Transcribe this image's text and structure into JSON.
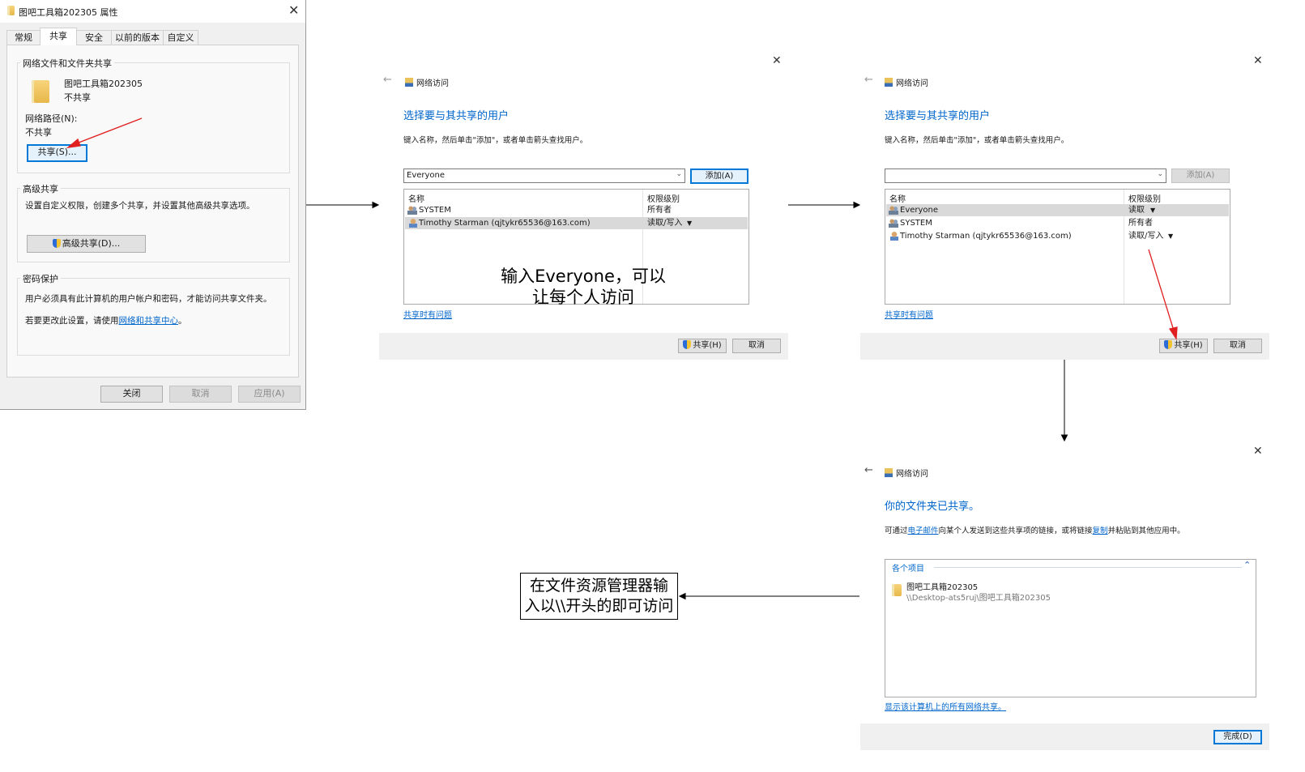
{
  "dialog": {
    "title": "图吧工具箱202305 属性",
    "tabs": [
      "常规",
      "共享",
      "安全",
      "以前的版本",
      "自定义"
    ],
    "active_tab_index": 1,
    "net_share_group": "网络文件和文件夹共享",
    "folder_name": "图吧工具箱202305",
    "folder_status": "不共享",
    "network_path_label": "网络路径(N):",
    "network_path_value": "不共享",
    "share_button": "共享(S)...",
    "advanced_group": "高级共享",
    "advanced_desc": "设置自定义权限，创建多个共享，并设置其他高级共享选项。",
    "advanced_button": "高级共享(D)...",
    "password_group": "密码保护",
    "password_desc": "用户必须具有此计算机的用户帐户和密码，才能访问共享文件夹。",
    "password_change_prefix": "若要更改此设置，请使用",
    "password_change_link": "网络和共享中心",
    "password_change_suffix": "。",
    "buttons": {
      "close": "关闭",
      "cancel": "取消",
      "apply": "应用(A)"
    }
  },
  "wizard1": {
    "window_title": "网络访问",
    "heading": "选择要与其共享的用户",
    "instruction": "键入名称，然后单击\"添加\"，或者单击箭头查找用户。",
    "input_value": "Everyone",
    "add_button": "添加(A)",
    "col_name": "名称",
    "col_perm": "权限级别",
    "rows": [
      {
        "name": "SYSTEM",
        "perm": "所有者"
      },
      {
        "name": "Timothy Starman (qjtykr65536@163.com)",
        "perm": "读取/写入"
      }
    ],
    "help_link": "共享时有问题",
    "share_button": "共享(H)",
    "cancel_button": "取消"
  },
  "wizard2": {
    "window_title": "网络访问",
    "heading": "选择要与其共享的用户",
    "instruction": "键入名称，然后单击\"添加\"，或者单击箭头查找用户。",
    "input_value": "",
    "add_button": "添加(A)",
    "col_name": "名称",
    "col_perm": "权限级别",
    "rows": [
      {
        "name": "Everyone",
        "perm": "读取"
      },
      {
        "name": "SYSTEM",
        "perm": "所有者"
      },
      {
        "name": "Timothy Starman (qjtykr65536@163.com)",
        "perm": "读取/写入"
      }
    ],
    "help_link": "共享时有问题",
    "share_button": "共享(H)",
    "cancel_button": "取消"
  },
  "wizard3": {
    "window_title": "网络访问",
    "heading": "你的文件夹已共享。",
    "instruction_prefix": "可通过",
    "email_link": "电子邮件",
    "instruction_mid": "向某个人发送到这些共享项的链接，或将链接",
    "copy_link": "复制",
    "instruction_suffix": "并粘贴到其他应用中。",
    "items_header": "各个项目",
    "item_name": "图吧工具箱202305",
    "item_path": "\\\\Desktop-ats5ruj\\图吧工具箱202305",
    "show_all_link": "显示该计算机上的所有网络共享。",
    "done_button": "完成(D)"
  },
  "annotations": {
    "note1": "输入Everyone，可以\n让每个人访问",
    "note2": "在文件资源管理器输\n入以\\\\开头的即可访问"
  },
  "colors": {
    "accent": "#0066cc",
    "arrow": "#e02020",
    "dialog_bg": "#f0f0f0"
  }
}
